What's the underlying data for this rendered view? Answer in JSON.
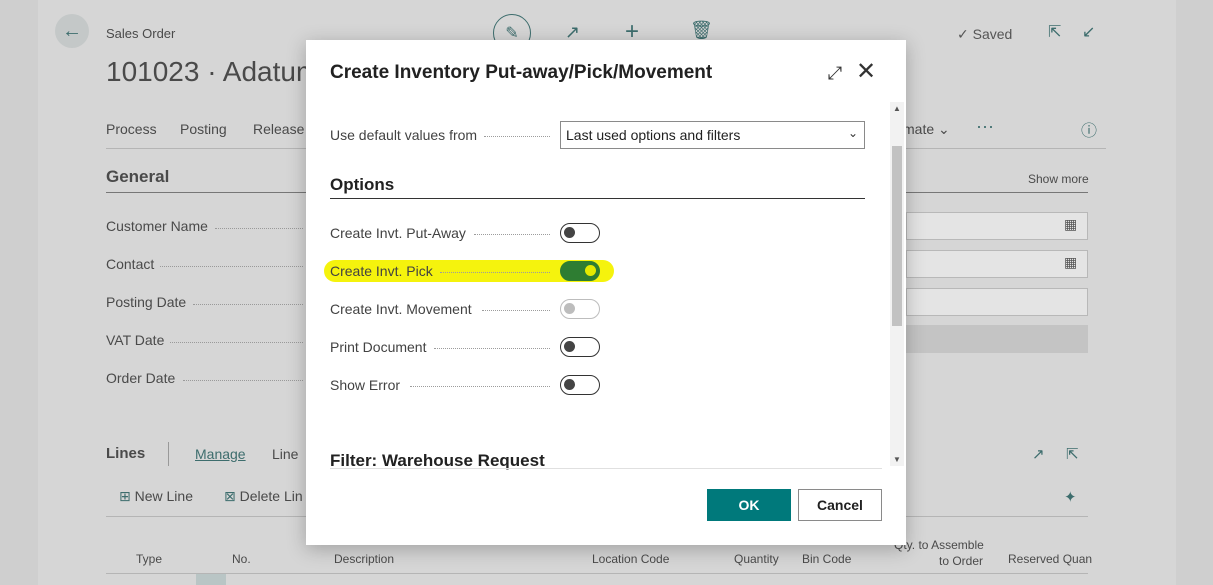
{
  "background": {
    "caption": "Sales Order",
    "title": "101023 · Adatum",
    "saved_label": "Saved",
    "actions": [
      "Process",
      "Posting",
      "Release"
    ],
    "automate_label": "mate",
    "more_actions": "···",
    "section_general": "General",
    "show_more": "Show more",
    "fields": [
      "Customer Name",
      "Contact",
      "Posting Date",
      "VAT Date",
      "Order Date"
    ],
    "lines_label": "Lines",
    "lines_tabs": [
      "Manage",
      "Line"
    ],
    "new_line": "New Line",
    "delete_line": "Delete Lin",
    "columns": {
      "type": "Type",
      "no": "No.",
      "description": "Description",
      "location": "Location Code",
      "quantity": "Quantity",
      "bin": "Bin Code",
      "qty_assemble_1": "Qty. to Assemble",
      "qty_assemble_2": "to Order",
      "reserved": "Reserved Quan"
    }
  },
  "dialog": {
    "title": "Create Inventory Put-away/Pick/Movement",
    "default_values_label": "Use default values from",
    "default_values_value": "Last used options and filters",
    "options_title": "Options",
    "options": [
      {
        "label": "Create Invt. Put-Away",
        "state": "off"
      },
      {
        "label": "Create Invt. Pick",
        "state": "on"
      },
      {
        "label": "Create Invt. Movement",
        "state": "disabled"
      },
      {
        "label": "Print Document",
        "state": "off"
      },
      {
        "label": "Show Error",
        "state": "off"
      }
    ],
    "filter_title": "Filter: Warehouse Request",
    "ok_label": "OK",
    "cancel_label": "Cancel"
  },
  "colors": {
    "accent": "#00797b",
    "toggle_on": "#2e7d32",
    "highlight": "#f4f200"
  }
}
